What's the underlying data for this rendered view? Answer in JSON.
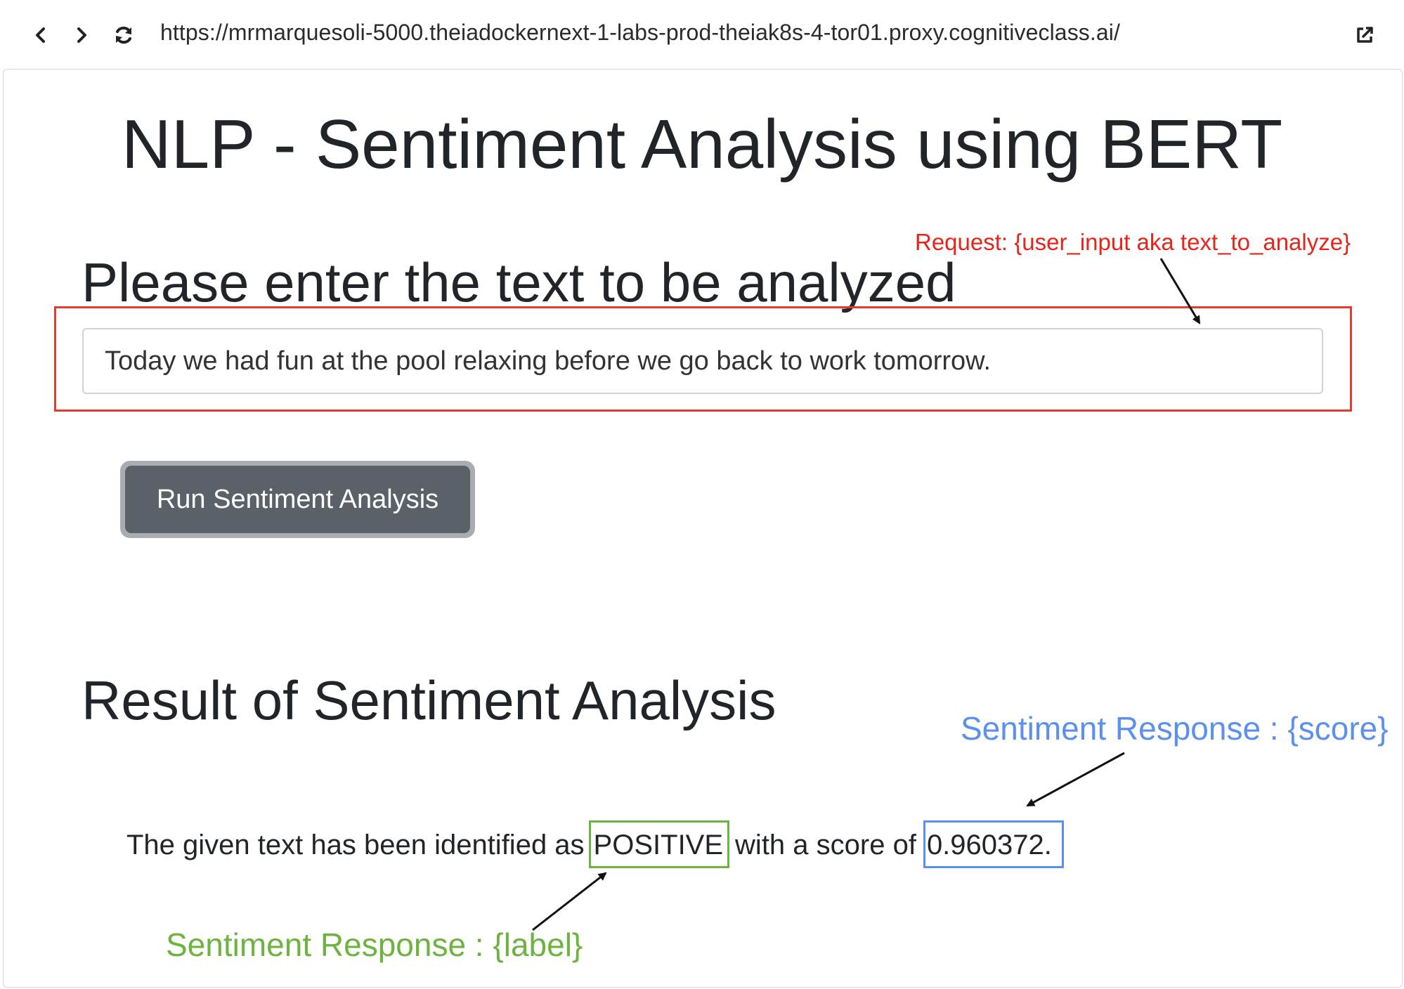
{
  "browser": {
    "url": "https://mrmarquesoli-5000.theiadockernext-1-labs-prod-theiak8s-4-tor01.proxy.cognitiveclass.ai/"
  },
  "page": {
    "title": "NLP - Sentiment Analysis using BERT",
    "input_heading": "Please enter the text to be analyzed",
    "input_value": "Today we had fun at the pool relaxing before we go back to work tomorrow.",
    "run_button_label": "Run Sentiment Analysis",
    "result_heading": "Result of Sentiment Analysis",
    "result": {
      "prefix": "The given text has been identified as",
      "label": "POSITIVE",
      "middle": "with a score of",
      "score": "0.960372."
    }
  },
  "annotations": {
    "request": "Request: {user_input aka text_to_analyze}",
    "score_response": "Sentiment Response : {score}",
    "label_response": "Sentiment Response : {label}"
  },
  "colors": {
    "request_annotation": "#e8241a",
    "score_annotation": "#5b8ff0",
    "label_annotation": "#6db33f",
    "button_bg": "#5a6169"
  },
  "icons": {
    "back": "chevron-left-icon",
    "forward": "chevron-right-icon",
    "reload": "refresh-icon",
    "open_external": "external-link-icon"
  }
}
